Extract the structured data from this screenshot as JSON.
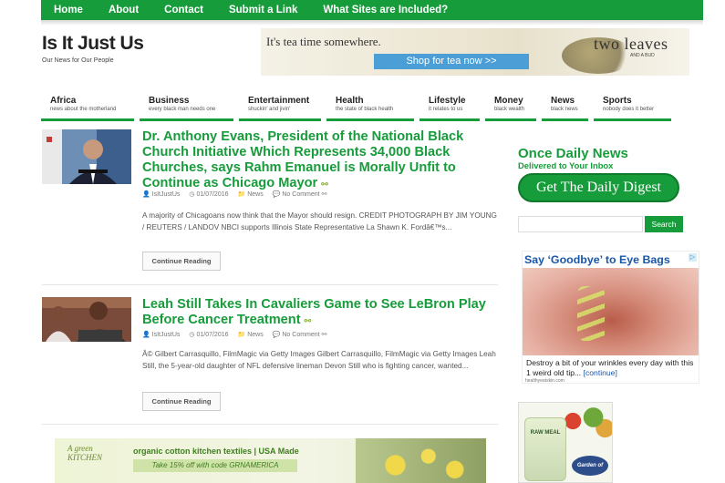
{
  "top_nav": [
    "Home",
    "About",
    "Contact",
    "Submit a Link",
    "What Sites are Included?"
  ],
  "site": {
    "title": "Is It Just Us",
    "tagline": "Our News for Our People"
  },
  "banner_ad": {
    "headline": "It's tea time somewhere.",
    "button": "Shop for tea now >>",
    "brand": "two leaves",
    "brand_sub": "AND A BUD"
  },
  "categories": [
    {
      "name": "Africa",
      "sub": "news about the motherland"
    },
    {
      "name": "Business",
      "sub": "every black man needs one"
    },
    {
      "name": "Entertainment",
      "sub": "shuckin' and jivin'"
    },
    {
      "name": "Health",
      "sub": "the state of black health"
    },
    {
      "name": "Lifestyle",
      "sub": "it relates to us"
    },
    {
      "name": "Money",
      "sub": "black wealth"
    },
    {
      "name": "News",
      "sub": "black news"
    },
    {
      "name": "Sports",
      "sub": "nobody does it better"
    }
  ],
  "posts": [
    {
      "title": "Dr. Anthony Evans, President of the National Black Church Initiative Which Represents 34,000 Black Churches, says Rahm Emanuel is Morally Unfit to Continue as Chicago Mayor",
      "author": "IsItJustUs",
      "date": "01/07/2016",
      "category": "News",
      "comments": "No Comment",
      "excerpt": "A majority of Chicagoans now think that the Mayor should resign. CREDIT PHOTOGRAPH BY JIM YOUNG / REUTERS / LANDOV NBCI supports Illinois State Representative La Shawn K. Fordâ€™s...",
      "button": "Continue Reading"
    },
    {
      "title": "Leah Still Takes In Cavaliers Game to See LeBron Play Before Cancer Treatment",
      "author": "IsItJustUs",
      "date": "01/07/2016",
      "category": "News",
      "comments": "No Comment",
      "excerpt": "Â© Gilbert Carrasquillo, FilmMagic via Getty Images Gilbert Carrasquillo, FilmMagic via Getty Images Leah Still, the 5-year-old daughter of NFL defensive lineman Devon Still who is fighting cancer, wanted...",
      "button": "Continue Reading"
    }
  ],
  "bottom_ad": {
    "logo": "A green KITCHEN",
    "line1": "organic cotton kitchen textiles | USA Made",
    "line2": "Take 15% off with code GRNAMERICA"
  },
  "sidebar": {
    "heading1": "Once Daily News",
    "heading2": "Delivered to Your Inbox",
    "digest_button": "Get The Daily Digest",
    "search_placeholder": "",
    "search_button": "Search",
    "ad": {
      "title": "Say ‘Goodbye’ to Eye Bags",
      "body": "Destroy a bit of your wrinkles every day with this 1 weird old tip...",
      "cont": "[continue]",
      "source": "healthyeatskin.com"
    },
    "product_ad": {
      "jar_label": "RAW MEAL",
      "brand": "Garden of Life"
    }
  }
}
